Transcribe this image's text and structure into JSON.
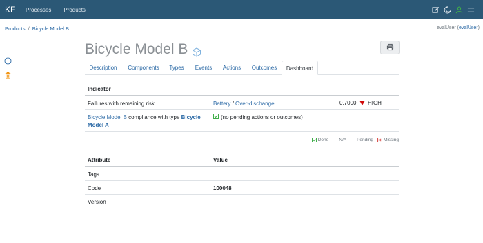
{
  "nav": {
    "brand": "KF",
    "links": [
      "Processes",
      "Products"
    ]
  },
  "breadcrumb": {
    "root": "Products",
    "separator": "/",
    "current": "Bicycle Model B"
  },
  "user": {
    "name": "evalUser",
    "link": "evalUser"
  },
  "title": "Bicycle Model B",
  "tabs": [
    "Description",
    "Components",
    "Types",
    "Events",
    "Actions",
    "Outcomes",
    "Dashboard"
  ],
  "active_tab": "Dashboard",
  "indicator_table": {
    "header": "Indicator",
    "rows": [
      {
        "label": "Failures with remaining risk",
        "link1": "Battery",
        "sep": "/",
        "link2": "Over-dischange",
        "value": "0.7000",
        "level": "HIGH"
      },
      {
        "label_link": "Bicycle Model B",
        "label_text": " compliance with type ",
        "label_link2": "Bicycle Model A",
        "status": "(no pending actions or outcomes)"
      }
    ]
  },
  "legend": {
    "done": "Done",
    "na": "N/A",
    "pending": "Pending",
    "missing": "Missing"
  },
  "attribute_table": {
    "col1": "Attribute",
    "col2": "Value",
    "rows": [
      {
        "attr": "Tags",
        "value": ""
      },
      {
        "attr": "Code",
        "value": "100048"
      },
      {
        "attr": "Version",
        "value": ""
      }
    ]
  },
  "colors": {
    "navbar": "#2b5876",
    "link": "#2c6aa6",
    "high": "#d10a0a",
    "done": "#3fae49",
    "pending": "#f0a030",
    "missing": "#d9534f",
    "add_icon": "#2c6aa6",
    "delete_icon": "#f08c00"
  },
  "icons": {
    "nav": [
      "edit-icon",
      "moon-icon",
      "user-icon",
      "menu-icon"
    ],
    "side": [
      "add-circle-icon",
      "trash-icon"
    ],
    "title": "cube-icon",
    "print": "printer-icon"
  }
}
